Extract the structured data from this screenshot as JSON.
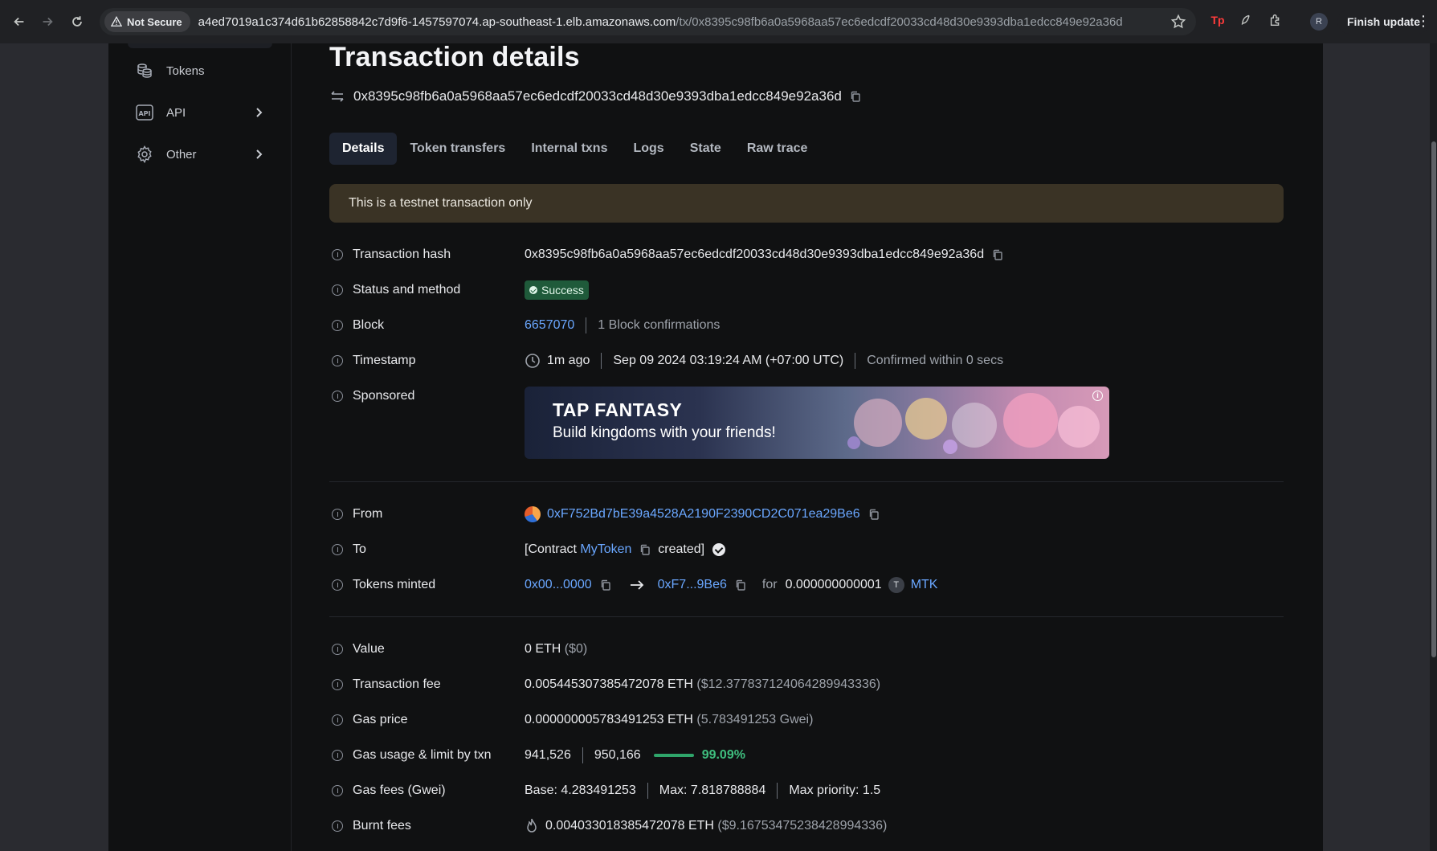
{
  "browser": {
    "security_label": "Not Secure",
    "url_host": "a4ed7019a1c374d61b62858842c7d9f6-1457597074.ap-southeast-1.elb.amazonaws.com",
    "url_path": "/tx/0x8395c98fb6a0a5968aa57ec6edcdf20033cd48d30e9393dba1edcc849e92a36d",
    "profile_initial": "R",
    "finish_update_label": "Finish update",
    "extension_text": "Tp"
  },
  "sidebar": {
    "items": [
      {
        "label": "Tokens",
        "icon": "coins-icon"
      },
      {
        "label": "API",
        "icon": "api-icon"
      },
      {
        "label": "Other",
        "icon": "gear-icon"
      }
    ]
  },
  "page": {
    "title": "Transaction details",
    "hash": "0x8395c98fb6a0a5968aa57ec6edcdf20033cd48d30e9393dba1edcc849e92a36d",
    "tabs": [
      "Details",
      "Token transfers",
      "Internal txns",
      "Logs",
      "State",
      "Raw trace"
    ],
    "active_tab": "Details",
    "banner": "This is a testnet transaction only"
  },
  "details": {
    "tx_hash": {
      "label": "Transaction hash",
      "value": "0x8395c98fb6a0a5968aa57ec6edcdf20033cd48d30e9393dba1edcc849e92a36d"
    },
    "status": {
      "label": "Status and method",
      "value": "Success"
    },
    "block": {
      "label": "Block",
      "number": "6657070",
      "confirmations": "1 Block confirmations"
    },
    "timestamp": {
      "label": "Timestamp",
      "ago": "1m ago",
      "date": "Sep 09 2024 03:19:24 AM (+07:00 UTC)",
      "confirmed": "Confirmed within 0 secs"
    },
    "sponsored": {
      "label": "Sponsored",
      "ad_title": "TAP FANTASY",
      "ad_subtitle": "Build kingdoms with your friends!"
    },
    "from": {
      "label": "From",
      "address": "0xF752Bd7bE39a4528A2190F2390CD2C071ea29Be6"
    },
    "to": {
      "label": "To",
      "prefix": "[Contract",
      "contract": "MyToken",
      "suffix": "created]"
    },
    "tokens_minted": {
      "label": "Tokens minted",
      "from": "0x00...0000",
      "to": "0xF7...9Be6",
      "for_label": "for",
      "amount": "0.000000000001",
      "token_initial": "T",
      "symbol": "MTK"
    },
    "value": {
      "label": "Value",
      "amount": "0 ETH",
      "usd": "($0)"
    },
    "tx_fee": {
      "label": "Transaction fee",
      "amount": "0.005445307385472078 ETH",
      "usd": "($12.377837124064289943336)"
    },
    "gas_price": {
      "label": "Gas price",
      "amount": "0.000000005783491253 ETH",
      "gwei": "(5.783491253 Gwei)"
    },
    "gas_usage": {
      "label": "Gas usage & limit by txn",
      "used": "941,526",
      "limit": "950,166",
      "percent": "99.09%",
      "fraction": 0.9909
    },
    "gas_fees": {
      "label": "Gas fees (Gwei)",
      "base": "Base: 4.283491253",
      "max": "Max: 7.818788884",
      "max_priority": "Max priority: 1.5"
    },
    "burnt_fees": {
      "label": "Burnt fees",
      "amount": "0.004033018385472078 ETH",
      "usd": "($9.16753475238428994336)"
    }
  },
  "colors": {
    "link": "#6aa7ff",
    "success_bg": "#1f5a3a",
    "banner_bg": "#3a3325",
    "gas_green": "#3fbf7f"
  }
}
